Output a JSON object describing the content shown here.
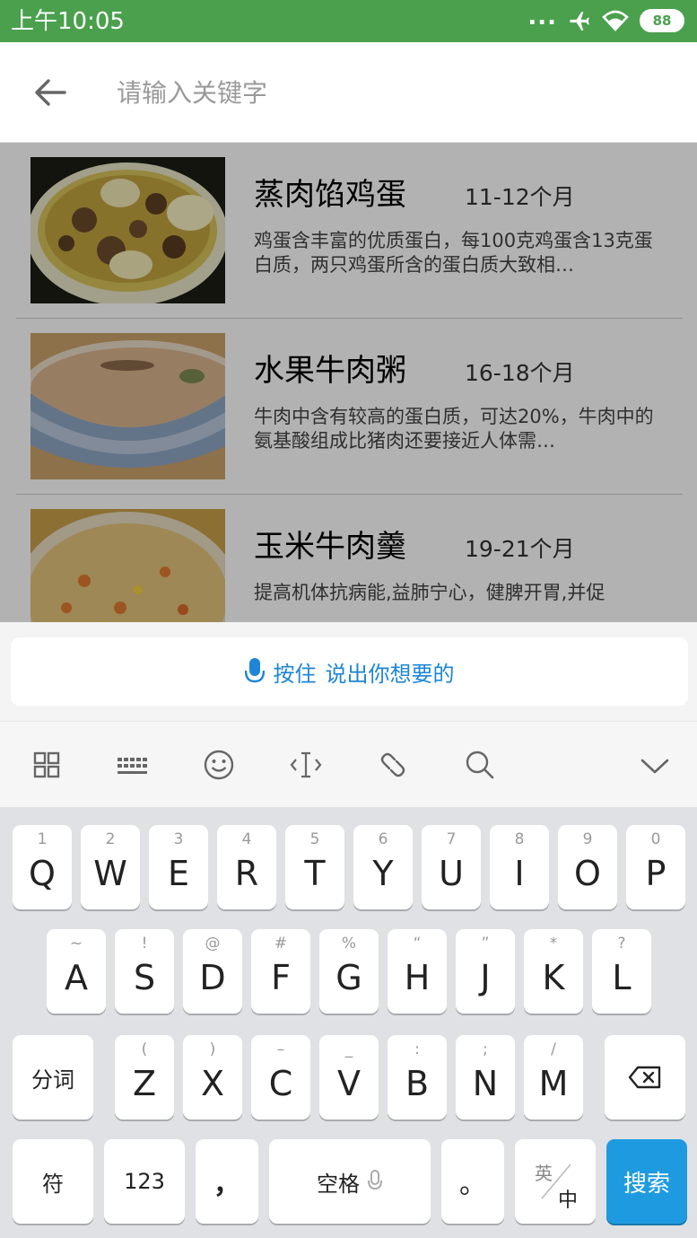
{
  "status_bar": {
    "time": "上午10:05",
    "dots": "...",
    "battery": "88"
  },
  "header": {
    "search_placeholder": "请输入关键字"
  },
  "items": [
    {
      "title": "蒸肉馅鸡蛋",
      "age": "11-12个月",
      "desc": " 鸡蛋含丰富的优质蛋白，每100克鸡蛋含13克蛋白质，两只鸡蛋所含的蛋白质大致相…"
    },
    {
      "title": "水果牛肉粥",
      "age": "16-18个月",
      "desc": "牛肉中含有较高的蛋白质，可达20%，牛肉中的氨基酸组成比猪肉还要接近人体需…"
    },
    {
      "title": "玉米牛肉羹",
      "age": "19-21个月",
      "desc": "提高机体抗病能,益肺宁心，健脾开胃,并促"
    }
  ],
  "voice": {
    "prefix": "按住",
    "label": "说出你想要的"
  },
  "keyboard": {
    "row1": [
      {
        "main": "Q",
        "hint": "1"
      },
      {
        "main": "W",
        "hint": "2"
      },
      {
        "main": "E",
        "hint": "3"
      },
      {
        "main": "R",
        "hint": "4"
      },
      {
        "main": "T",
        "hint": "5"
      },
      {
        "main": "Y",
        "hint": "6"
      },
      {
        "main": "U",
        "hint": "7"
      },
      {
        "main": "I",
        "hint": "8"
      },
      {
        "main": "O",
        "hint": "9"
      },
      {
        "main": "P",
        "hint": "0"
      }
    ],
    "row2": [
      {
        "main": "A",
        "hint": "~"
      },
      {
        "main": "S",
        "hint": "!"
      },
      {
        "main": "D",
        "hint": "@"
      },
      {
        "main": "F",
        "hint": "#"
      },
      {
        "main": "G",
        "hint": "%"
      },
      {
        "main": "H",
        "hint": "“"
      },
      {
        "main": "J",
        "hint": "”"
      },
      {
        "main": "K",
        "hint": "*"
      },
      {
        "main": "L",
        "hint": "?"
      }
    ],
    "row3": [
      {
        "main": "Z",
        "hint": "("
      },
      {
        "main": "X",
        "hint": ")"
      },
      {
        "main": "C",
        "hint": "–"
      },
      {
        "main": "V",
        "hint": "_"
      },
      {
        "main": "B",
        "hint": ":"
      },
      {
        "main": "N",
        "hint": ";"
      },
      {
        "main": "M",
        "hint": "/"
      }
    ],
    "fenci": "分词",
    "symbols": "符",
    "numbers": "123",
    "comma": "，",
    "space": "空格",
    "period": "。",
    "lang_top": "英",
    "lang_bottom": "中",
    "search": "搜索"
  },
  "colors": {
    "status_bar": "#4aa04d",
    "accent": "#1e86d6",
    "search_key": "#1e9be0"
  }
}
